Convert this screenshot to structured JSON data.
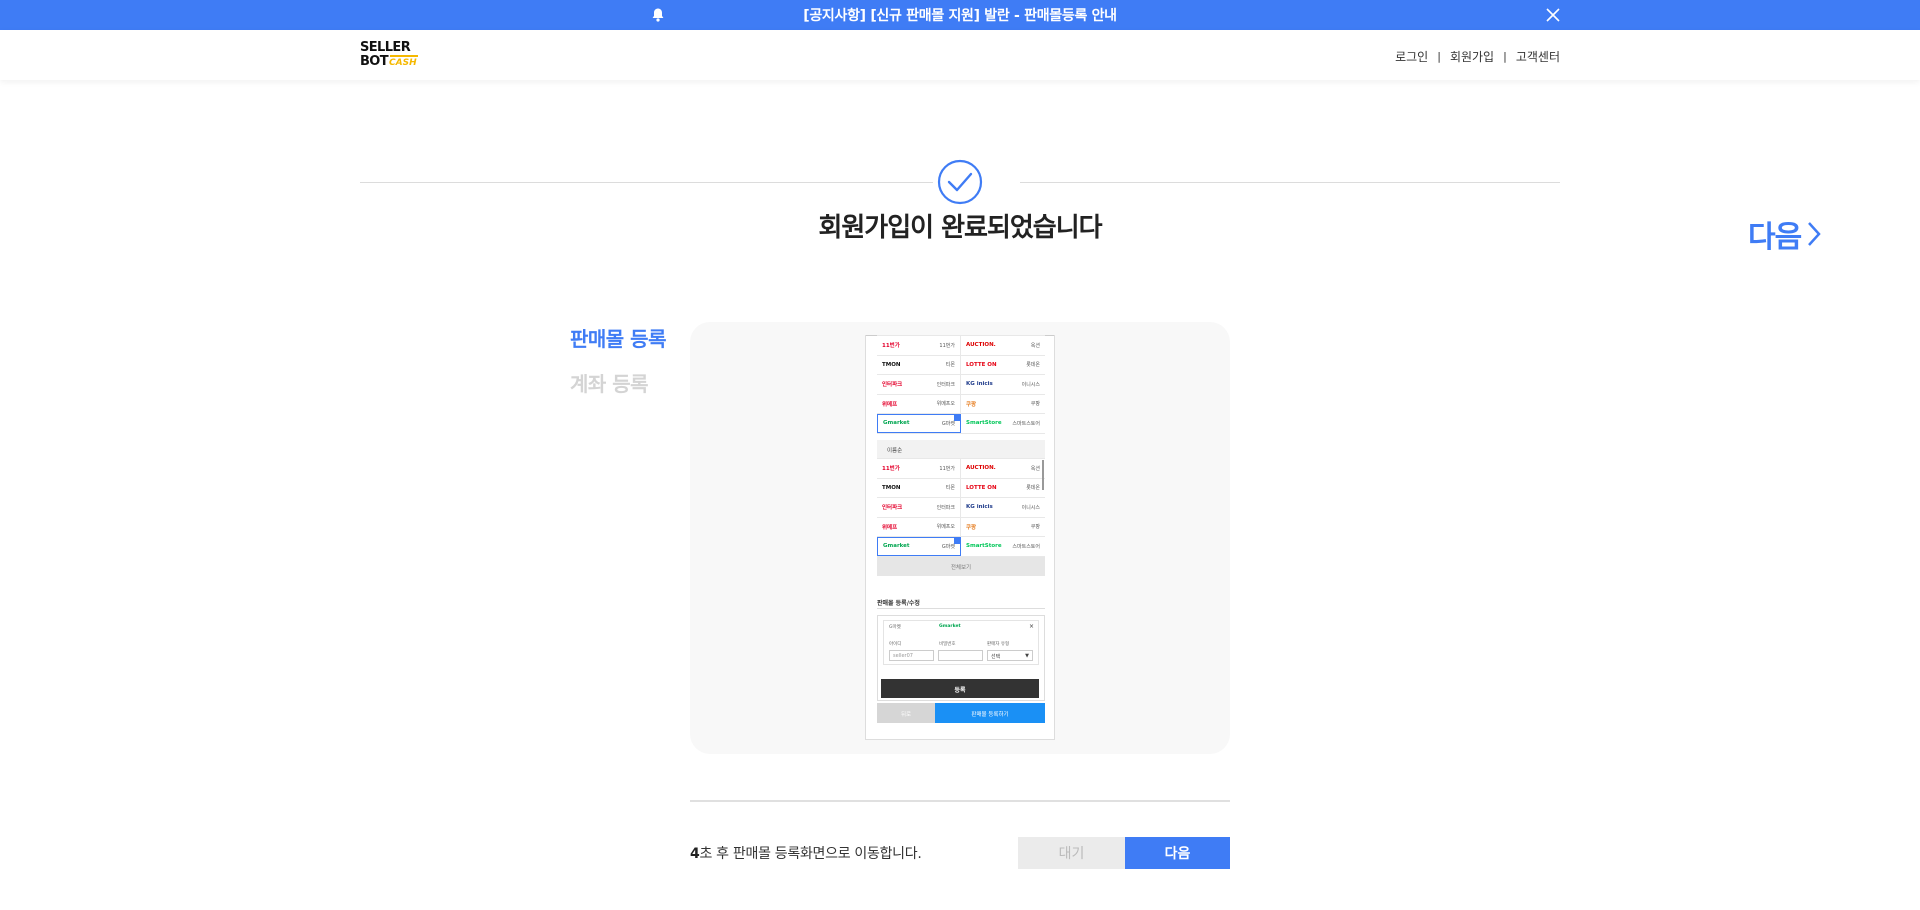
{
  "notice": {
    "text": "[공지사항] [신규 판매몰 지원] 발란 - 판매몰등록 안내",
    "bell_icon": "bell-icon",
    "close_icon": "close-icon",
    "bg_color": "#3f7cf5"
  },
  "header": {
    "logo": {
      "line1": "SELLER",
      "line2": "BOT",
      "line2_suffix": "CASH"
    },
    "nav": [
      {
        "label": "로그인"
      },
      {
        "label": "회원가입"
      },
      {
        "label": "고객센터"
      }
    ],
    "separator": "|"
  },
  "hero": {
    "check_icon": "check-circle-icon",
    "title": "회원가입이 완료되었습니다",
    "next_label": "다음",
    "next_icon": "chevron-right-icon",
    "accent_color": "#3f7cf5"
  },
  "steps": [
    {
      "label": "판매몰 등록",
      "active": true
    },
    {
      "label": "계좌 등록",
      "active": false
    }
  ],
  "preview": {
    "grid1": [
      [
        {
          "logo": "11번가",
          "name": "11번가"
        },
        {
          "logo": "AUCTION.",
          "name": "옥션"
        }
      ],
      [
        {
          "logo": "TMON",
          "name": "티몬"
        },
        {
          "logo": "LOTTE ON",
          "name": "롯데온"
        }
      ],
      [
        {
          "logo": "인터파크",
          "name": "인터파크"
        },
        {
          "logo": "KG inicis",
          "name": "이니시스"
        }
      ],
      [
        {
          "logo": "위메프",
          "name": "위메프오"
        },
        {
          "logo": "쿠팡",
          "name": "쿠팡"
        }
      ],
      [
        {
          "logo": "Gmarket",
          "name": "G마켓"
        },
        {
          "logo": "SmartStore",
          "name": "스마트스토어"
        }
      ]
    ],
    "section_label": "이름순",
    "grid2": [
      [
        {
          "logo": "11번가",
          "name": "11번가"
        },
        {
          "logo": "AUCTION.",
          "name": "옥션"
        }
      ],
      [
        {
          "logo": "TMON",
          "name": "티몬"
        },
        {
          "logo": "LOTTE ON",
          "name": "롯데온"
        }
      ],
      [
        {
          "logo": "인터파크",
          "name": "인터파크"
        },
        {
          "logo": "KG inicis",
          "name": "이니시스"
        }
      ],
      [
        {
          "logo": "위메프",
          "name": "위메프오"
        },
        {
          "logo": "쿠팡",
          "name": "쿠팡"
        }
      ],
      [
        {
          "logo": "Gmarket",
          "name": "G마켓"
        },
        {
          "logo": "SmartStore",
          "name": "스마트스토어"
        }
      ]
    ],
    "more_label": "전체보기",
    "form_title": "판매몰 등록/수정",
    "form": {
      "mall_name": "G마켓",
      "mall_logo": "Gmarket",
      "id_label": "아이디",
      "id_value": "seller07",
      "pw_label": "비밀번호",
      "type_label": "판매자 유형",
      "type_value": "선택",
      "submit_label": "등록"
    },
    "btn_left": "뒤로",
    "btn_right": "판매몰 등록하기"
  },
  "footer": {
    "countdown_num": "4",
    "countdown_text": "초 후 판매몰 등록화면으로 이동합니다.",
    "wait_label": "대기",
    "next_label": "다음"
  }
}
